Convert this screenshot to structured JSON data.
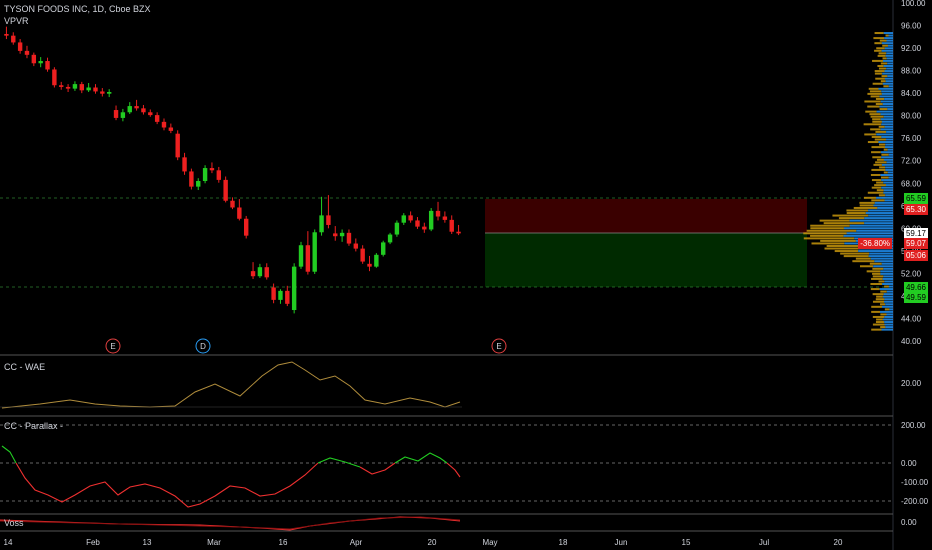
{
  "header": {
    "title": "TYSON FOODS INC, 1D, Cboe BZX",
    "indicator": "VPVR"
  },
  "panes": {
    "wae": "CC - WAE",
    "parallax": "CC - Parallax -",
    "voss": "Voss"
  },
  "price_axis": [
    "96.00",
    "92.00",
    "88.00",
    "84.00",
    "80.00",
    "76.00",
    "72.00",
    "68.00",
    "64.00",
    "60.00",
    "56.00",
    "52.00",
    "48.00",
    "44.00",
    "40.00"
  ],
  "price_axis_top": "100.00",
  "price_tags": [
    {
      "label": "65.59",
      "color": "#22cc22",
      "text": "#000"
    },
    {
      "label": "65.30",
      "color": "#e02020",
      "text": "#fff"
    },
    {
      "label": "59.17",
      "color": "#ffffff",
      "text": "#000"
    },
    {
      "label": "-36.80%",
      "color": "#e02020",
      "text": "#fff"
    },
    {
      "label": "59.07",
      "color": "#e02020",
      "text": "#fff"
    },
    {
      "label": "05:06",
      "color": "#e02020",
      "text": "#fff"
    },
    {
      "label": "49.66",
      "color": "#22cc22",
      "text": "#000"
    },
    {
      "label": "49.59",
      "color": "#22cc22",
      "text": "#000"
    }
  ],
  "wae_axis": [
    "20.00"
  ],
  "parallax_axis": [
    "200.00",
    "0.00",
    "-100.00",
    "-200.00"
  ],
  "voss_axis": [
    "0.00"
  ],
  "time_axis": [
    "14",
    "Feb",
    "13",
    "Mar",
    "16",
    "Apr",
    "20",
    "May",
    "18",
    "Jun",
    "15",
    "Jul",
    "20"
  ],
  "events": [
    "E",
    "D",
    "E"
  ],
  "colors": {
    "up": "#22cc22",
    "down": "#ee2020",
    "profit": "#3a0000",
    "loss": "#002a00",
    "vp_blue": "#1e88e5",
    "vp_gold": "#c8960c"
  },
  "chart_data": {
    "type": "candlestick",
    "title": "TYSON FOODS INC, 1D, Cboe BZX",
    "ylim": [
      40,
      100
    ],
    "candles": [
      [
        94.5,
        95.8,
        93.6,
        94.2
      ],
      [
        94.2,
        94.8,
        92.6,
        93.0
      ],
      [
        93.0,
        93.6,
        91.0,
        91.5
      ],
      [
        91.5,
        92.4,
        90.2,
        90.8
      ],
      [
        90.8,
        91.2,
        88.8,
        89.3
      ],
      [
        89.3,
        90.4,
        88.6,
        89.7
      ],
      [
        89.7,
        90.3,
        87.8,
        88.2
      ],
      [
        88.2,
        88.6,
        85.0,
        85.4
      ],
      [
        85.4,
        86.0,
        84.6,
        85.1
      ],
      [
        85.1,
        85.6,
        84.2,
        84.8
      ],
      [
        84.8,
        86.1,
        84.4,
        85.6
      ],
      [
        85.6,
        86.0,
        84.0,
        84.5
      ],
      [
        84.5,
        85.8,
        84.2,
        85.0
      ],
      [
        85.0,
        85.6,
        83.9,
        84.3
      ],
      [
        84.3,
        84.9,
        83.4,
        83.9
      ],
      [
        83.9,
        84.7,
        83.3,
        84.2
      ],
      [
        81.0,
        81.8,
        79.2,
        79.6
      ],
      [
        79.6,
        81.2,
        79.0,
        80.6
      ],
      [
        80.6,
        82.4,
        80.3,
        81.7
      ],
      [
        81.7,
        82.8,
        80.9,
        81.3
      ],
      [
        81.3,
        81.9,
        80.2,
        80.6
      ],
      [
        80.6,
        81.1,
        79.8,
        80.1
      ],
      [
        80.1,
        80.6,
        78.5,
        78.9
      ],
      [
        78.9,
        79.5,
        77.4,
        77.9
      ],
      [
        77.9,
        78.6,
        76.9,
        77.3
      ],
      [
        76.8,
        77.4,
        72.1,
        72.6
      ],
      [
        72.6,
        73.4,
        69.5,
        70.1
      ],
      [
        70.1,
        70.6,
        66.9,
        67.4
      ],
      [
        67.4,
        68.9,
        66.8,
        68.4
      ],
      [
        68.4,
        71.2,
        68.0,
        70.7
      ],
      [
        70.7,
        71.7,
        69.8,
        70.3
      ],
      [
        70.3,
        70.9,
        68.1,
        68.6
      ],
      [
        68.6,
        69.2,
        64.6,
        64.9
      ],
      [
        64.9,
        65.5,
        63.4,
        63.7
      ],
      [
        63.7,
        65.2,
        61.4,
        61.7
      ],
      [
        61.7,
        62.2,
        58.2,
        58.7
      ],
      [
        52.4,
        54.0,
        51.0,
        51.5
      ],
      [
        51.5,
        53.7,
        51.2,
        53.1
      ],
      [
        53.1,
        53.8,
        50.9,
        51.3
      ],
      [
        49.5,
        50.2,
        46.7,
        47.3
      ],
      [
        47.3,
        49.2,
        46.6,
        48.9
      ],
      [
        48.9,
        49.8,
        46.2,
        46.6
      ],
      [
        45.5,
        53.8,
        44.9,
        53.2
      ],
      [
        53.2,
        57.6,
        52.8,
        57.0
      ],
      [
        57.0,
        59.5,
        51.8,
        52.3
      ],
      [
        52.3,
        59.8,
        51.9,
        59.3
      ],
      [
        59.3,
        65.6,
        58.7,
        62.3
      ],
      [
        62.3,
        65.9,
        60.0,
        60.6
      ],
      [
        59.1,
        60.4,
        57.8,
        58.6
      ],
      [
        58.6,
        59.8,
        57.6,
        59.2
      ],
      [
        59.2,
        59.8,
        56.9,
        57.3
      ],
      [
        57.3,
        58.2,
        55.9,
        56.4
      ],
      [
        56.4,
        57.0,
        53.7,
        54.1
      ],
      [
        53.7,
        55.1,
        52.4,
        53.2
      ],
      [
        53.2,
        55.6,
        53.0,
        55.3
      ],
      [
        55.3,
        57.8,
        55.0,
        57.5
      ],
      [
        57.5,
        59.2,
        57.2,
        58.9
      ],
      [
        58.9,
        61.4,
        58.5,
        61.0
      ],
      [
        61.0,
        62.7,
        60.6,
        62.3
      ],
      [
        62.3,
        63.0,
        61.0,
        61.4
      ],
      [
        61.4,
        62.0,
        59.9,
        60.3
      ],
      [
        60.3,
        61.0,
        59.2,
        59.8
      ],
      [
        59.8,
        63.6,
        59.5,
        63.1
      ],
      [
        63.1,
        64.7,
        61.4,
        62.1
      ],
      [
        62.1,
        63.0,
        61.0,
        61.5
      ],
      [
        61.5,
        62.3,
        59.0,
        59.4
      ],
      [
        59.4,
        60.6,
        58.8,
        59.1
      ]
    ],
    "levels": {
      "target": 65.59,
      "entry": 59.17,
      "stop": 49.66
    }
  }
}
